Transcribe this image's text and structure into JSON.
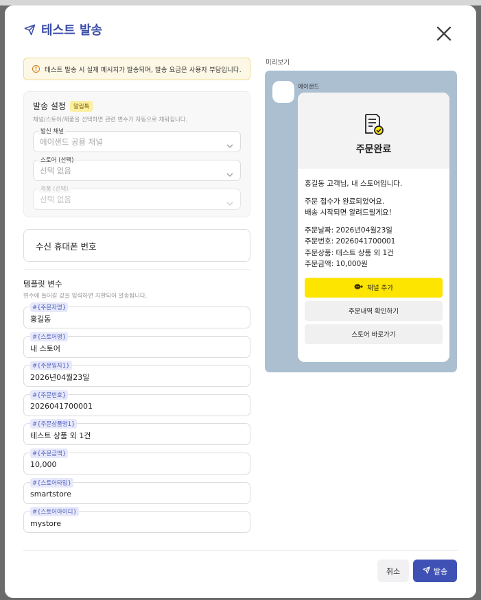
{
  "header": {
    "title": "테스트 발송"
  },
  "notice": {
    "text": "테스트 발송 시 실제 메시지가 발송되며, 발송 요금은 사용자 부담입니다."
  },
  "settings": {
    "title": "발송 설정",
    "badge": "알림톡",
    "desc": "채널/스토어/제품을 선택하면 관련 변수가 자동으로 채워집니다.",
    "fields": [
      {
        "label": "발신 채널",
        "value": "에이샌드 공용 채널"
      },
      {
        "label": "스토어 (선택)",
        "value": "선택 없음"
      },
      {
        "label": "제품 (선택)",
        "value": "선택 없음"
      }
    ]
  },
  "phone": {
    "placeholder": "수신 휴대폰 번호"
  },
  "template": {
    "title": "템플릿 변수",
    "desc": "변수에 들어갈 값을 입력하면 치환되어 발송됩니다.",
    "vars": [
      {
        "key": "#{주문자명}",
        "value": "홍길동"
      },
      {
        "key": "#{스토어명}",
        "value": "내 스토어"
      },
      {
        "key": "#{주문일자1}",
        "value": "2026년04월23일"
      },
      {
        "key": "#{주문번호}",
        "value": "2026041700001"
      },
      {
        "key": "#{주문상품명1}",
        "value": "테스트 상품 외 1건"
      },
      {
        "key": "#{주문금액}",
        "value": "10,000"
      },
      {
        "key": "#{스토어타입}",
        "value": "smartstore"
      },
      {
        "key": "#{스토어아이디}",
        "value": "mystore"
      }
    ]
  },
  "preview": {
    "label": "미리보기",
    "sender": "에이샌드",
    "title": "주문완료",
    "lines": {
      "l1": "홍길동 고객님, 내 스토어입니다.",
      "l2": "주문 접수가 완료되었어요.",
      "l3": "배송 시작되면 알려드릴게요!",
      "l4": "주문날짜: 2026년04월23일",
      "l5": "주문번호: 2026041700001",
      "l6": "주문상품: 테스트 상품 외 1건",
      "l7": "주문금액: 10,000원"
    },
    "buttons": {
      "add_channel": "채널 추가",
      "order_detail": "주문내역 확인하기",
      "go_store": "스토어 바로가기"
    }
  },
  "footer": {
    "cancel": "취소",
    "submit": "발송"
  },
  "colors": {
    "accent": "#3f51b5",
    "kakao_yellow": "#fee500",
    "preview_bg": "#abbfd1"
  }
}
